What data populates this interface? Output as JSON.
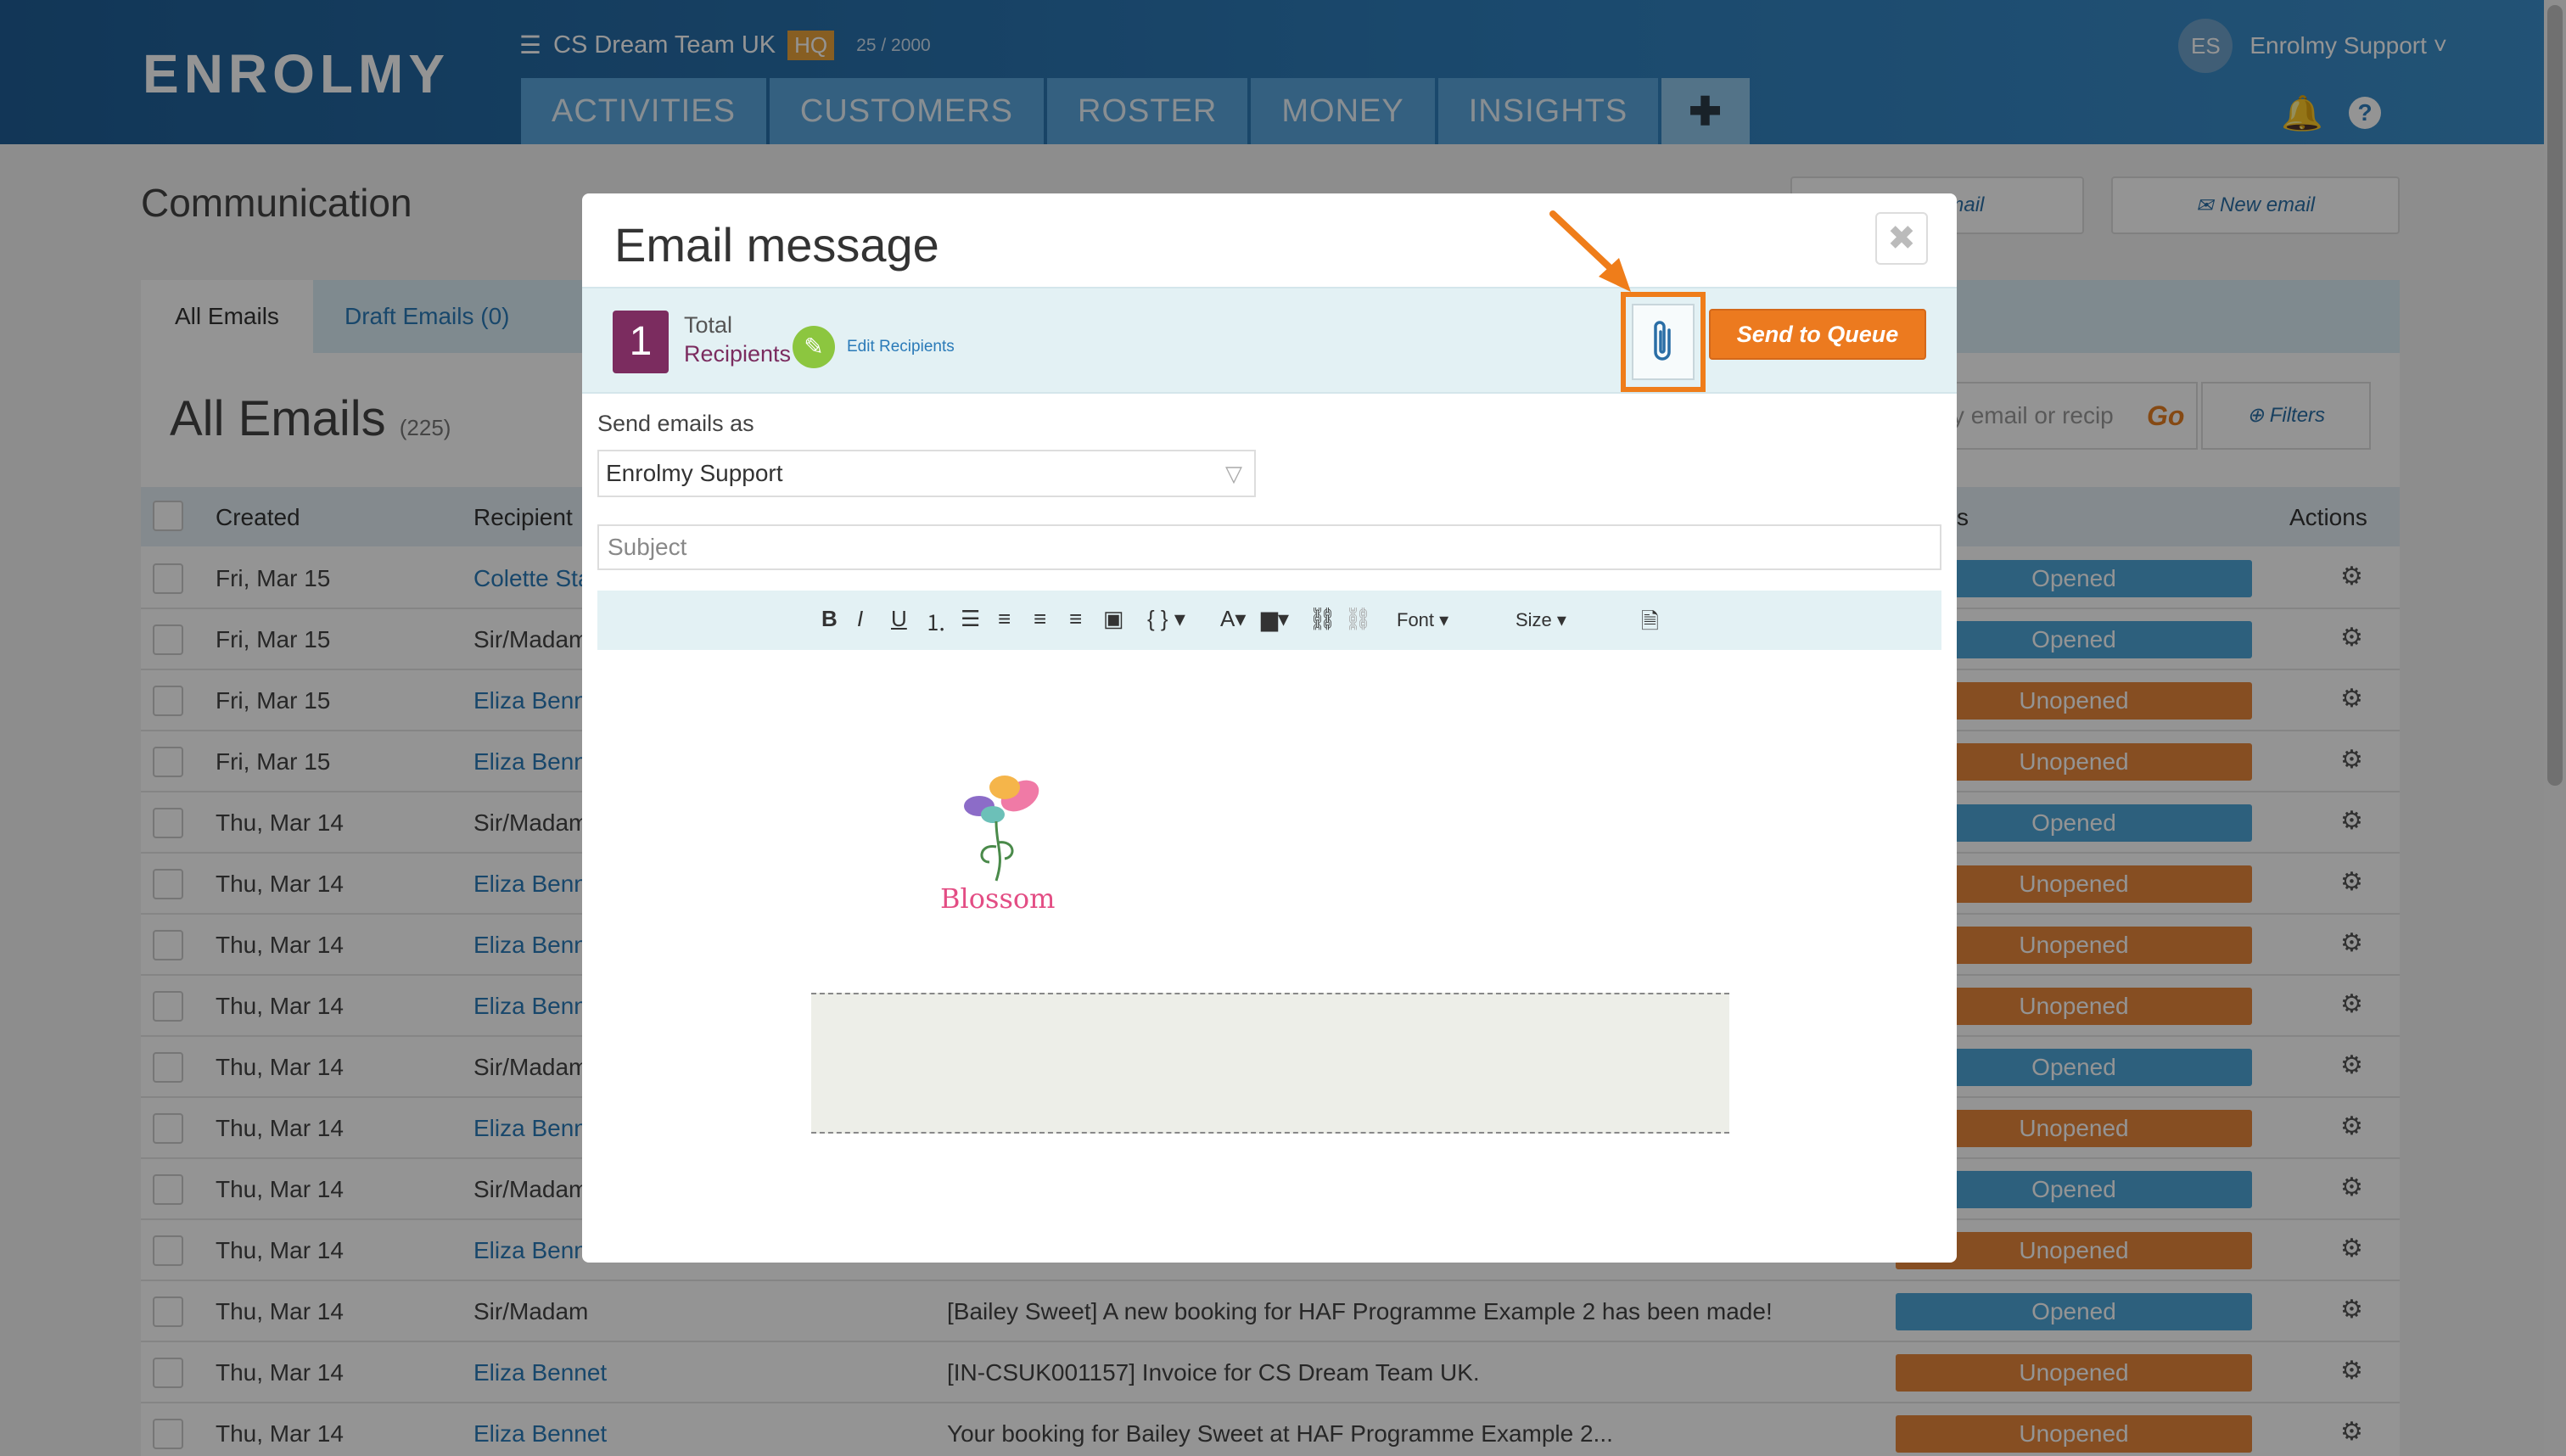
{
  "header": {
    "logo": "ENROLMY",
    "team_name": "CS Dream Team UK",
    "team_badge": "HQ",
    "usage": "25 / 2000",
    "tabs": [
      "ACTIVITIES",
      "CUSTOMERS",
      "ROSTER",
      "MONEY",
      "INSIGHTS"
    ],
    "add_tab": "✚",
    "user_initials": "ES",
    "user_name": "Enrolmy Support ˅"
  },
  "page": {
    "title": "Communication",
    "top_buttons": [
      "e an email",
      "New email"
    ],
    "subtabs": {
      "all": "All Emails",
      "draft": "Draft Emails (0)"
    },
    "section_title": "All Emails",
    "section_count": "(225)",
    "search_placeholder": "h by email or recip",
    "go": "Go",
    "filters": "Filters"
  },
  "table": {
    "headers": {
      "created": "Created",
      "recipient": "Recipient",
      "status": "s",
      "actions": "Actions"
    },
    "rows": [
      {
        "date": "Fri, Mar 15",
        "recipient": "Colette Sta",
        "link": true,
        "subject": "",
        "status": "Opened"
      },
      {
        "date": "Fri, Mar 15",
        "recipient": "Sir/Madam",
        "link": false,
        "subject": "",
        "status": "Opened"
      },
      {
        "date": "Fri, Mar 15",
        "recipient": "Eliza Benn",
        "link": true,
        "subject": "",
        "status": "Unopened"
      },
      {
        "date": "Fri, Mar 15",
        "recipient": "Eliza Benn",
        "link": true,
        "subject": "",
        "status": "Unopened"
      },
      {
        "date": "Thu, Mar 14",
        "recipient": "Sir/Madam",
        "link": false,
        "subject": "",
        "status": "Opened"
      },
      {
        "date": "Thu, Mar 14",
        "recipient": "Eliza Benn",
        "link": true,
        "subject": "",
        "status": "Unopened"
      },
      {
        "date": "Thu, Mar 14",
        "recipient": "Eliza Benn",
        "link": true,
        "subject": "",
        "status": "Unopened"
      },
      {
        "date": "Thu, Mar 14",
        "recipient": "Eliza Benn",
        "link": true,
        "subject": "",
        "status": "Unopened"
      },
      {
        "date": "Thu, Mar 14",
        "recipient": "Sir/Madam",
        "link": false,
        "subject": "",
        "status": "Opened"
      },
      {
        "date": "Thu, Mar 14",
        "recipient": "Eliza Benn",
        "link": true,
        "subject": "",
        "status": "Unopened"
      },
      {
        "date": "Thu, Mar 14",
        "recipient": "Sir/Madam",
        "link": false,
        "subject": "",
        "status": "Opened"
      },
      {
        "date": "Thu, Mar 14",
        "recipient": "Eliza Benn",
        "link": true,
        "subject": "",
        "status": "Unopened"
      },
      {
        "date": "Thu, Mar 14",
        "recipient": "Sir/Madam",
        "link": false,
        "subject": "[Bailey Sweet] A new booking for HAF Programme Example 2 has been made!",
        "status": "Opened"
      },
      {
        "date": "Thu, Mar 14",
        "recipient": "Eliza Bennet",
        "link": true,
        "subject": "[IN-CSUK001157] Invoice for CS Dream Team UK.",
        "status": "Unopened"
      },
      {
        "date": "Thu, Mar 14",
        "recipient": "Eliza Bennet",
        "link": true,
        "subject": "Your booking for Bailey Sweet at HAF Programme Example 2...",
        "status": "Unopened"
      }
    ]
  },
  "modal": {
    "title": "Email message",
    "close": "✖",
    "recipient_count": "1",
    "total_label": "Total",
    "recipients_label": "Recipients",
    "edit_recipients": "Edit Recipients",
    "send_to_queue": "Send to Queue",
    "send_as_label": "Send emails as",
    "send_as_value": "Enrolmy Support",
    "subject_placeholder": "Subject",
    "toolbar": {
      "font": "Font",
      "size": "Size"
    },
    "logo_caption": "Blossom"
  },
  "colors": {
    "accent": "#ec7a1f",
    "opened": "#4fa6d8",
    "unopened": "#e7873c",
    "header": "#2f7fbd"
  }
}
